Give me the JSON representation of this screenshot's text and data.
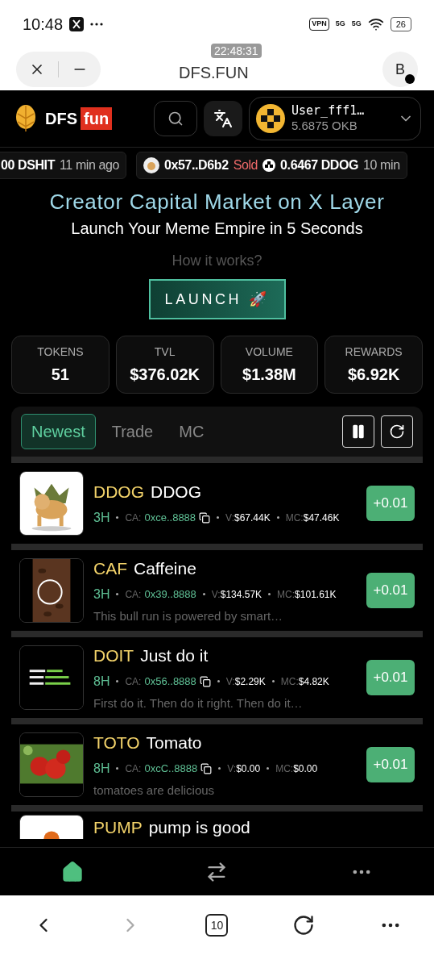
{
  "status_bar": {
    "time": "10:48",
    "vpn": "VPN",
    "networks": [
      "5G",
      "5G"
    ],
    "battery": "26"
  },
  "browser_bar": {
    "title": "DFS.FUN",
    "overlay_time": "22:48:31",
    "avatar": "B"
  },
  "header": {
    "logo_text": "DFS",
    "logo_badge": "fun",
    "user": {
      "name": "User_fff1…",
      "balance": "5.6875 OKB"
    }
  },
  "ticker": [
    {
      "kind": "plain",
      "address": "00 DSHIT",
      "time": "11 min ago"
    },
    {
      "kind": "sold",
      "address": "0x57..D6b2",
      "action": "Sold",
      "amount": "0.6467 DDOG",
      "time": "10 min"
    }
  ],
  "hero": {
    "title": "Creator Capital Market on X Layer",
    "subtitle": "Launch Your Meme Empire in 5 Seconds",
    "link": "How it works?",
    "button": "LAUNCH 🚀"
  },
  "stats": [
    {
      "label": "TOKENS",
      "value": "51"
    },
    {
      "label": "TVL",
      "value": "$376.02K"
    },
    {
      "label": "VOLUME",
      "value": "$1.38M"
    },
    {
      "label": "REWARDS",
      "value": "$6.92K"
    }
  ],
  "tabs": [
    {
      "label": "Newest",
      "selected": true
    },
    {
      "label": "Trade",
      "selected": false
    },
    {
      "label": "MC",
      "selected": false
    }
  ],
  "tokens": [
    {
      "kind": "full",
      "symbol": "DDOG",
      "name": "DDOG",
      "age": "3H",
      "ca_label": "CA:",
      "ca": "0xce..8888",
      "copy": true,
      "v_label": "V:",
      "volume": "$67.44K",
      "mc_label": "MC:",
      "mc": "$47.46K",
      "button": "+0.01"
    },
    {
      "kind": "full",
      "symbol": "CAF",
      "name": "Caffeine",
      "age": "3H",
      "ca_label": "CA:",
      "ca": "0x39..8888",
      "copy": false,
      "v_label": "V:",
      "volume": "$134.57K",
      "mc_label": "MC:",
      "mc": "$101.61K",
      "description": "This bull run is powered by smart…",
      "button": "+0.01"
    },
    {
      "kind": "full",
      "symbol": "DOIT",
      "name": "Just do it",
      "age": "8H",
      "ca_label": "CA:",
      "ca": "0x56..8888",
      "copy": true,
      "v_label": "V:",
      "volume": "$2.29K",
      "mc_label": "MC:",
      "mc": "$4.82K",
      "description": "First do it. Then do it right. Then do it…",
      "button": "+0.01"
    },
    {
      "kind": "full",
      "symbol": "TOTO",
      "name": "Tomato",
      "age": "8H",
      "ca_label": "CA:",
      "ca": "0xcC..8888",
      "copy": true,
      "v_label": "V:",
      "volume": "$0.00",
      "mc_label": "MC:",
      "mc": "$0.00",
      "description": "tomatoes are delicious",
      "button": "+0.01"
    },
    {
      "kind": "partial",
      "symbol": "PUMP",
      "name": "pump is good"
    }
  ],
  "bottom_nav": [
    {
      "kind": "home",
      "selected": true
    },
    {
      "kind": "swap",
      "selected": false
    },
    {
      "kind": "more",
      "selected": false
    }
  ],
  "browser_nav": {
    "tabs_count": "10"
  }
}
